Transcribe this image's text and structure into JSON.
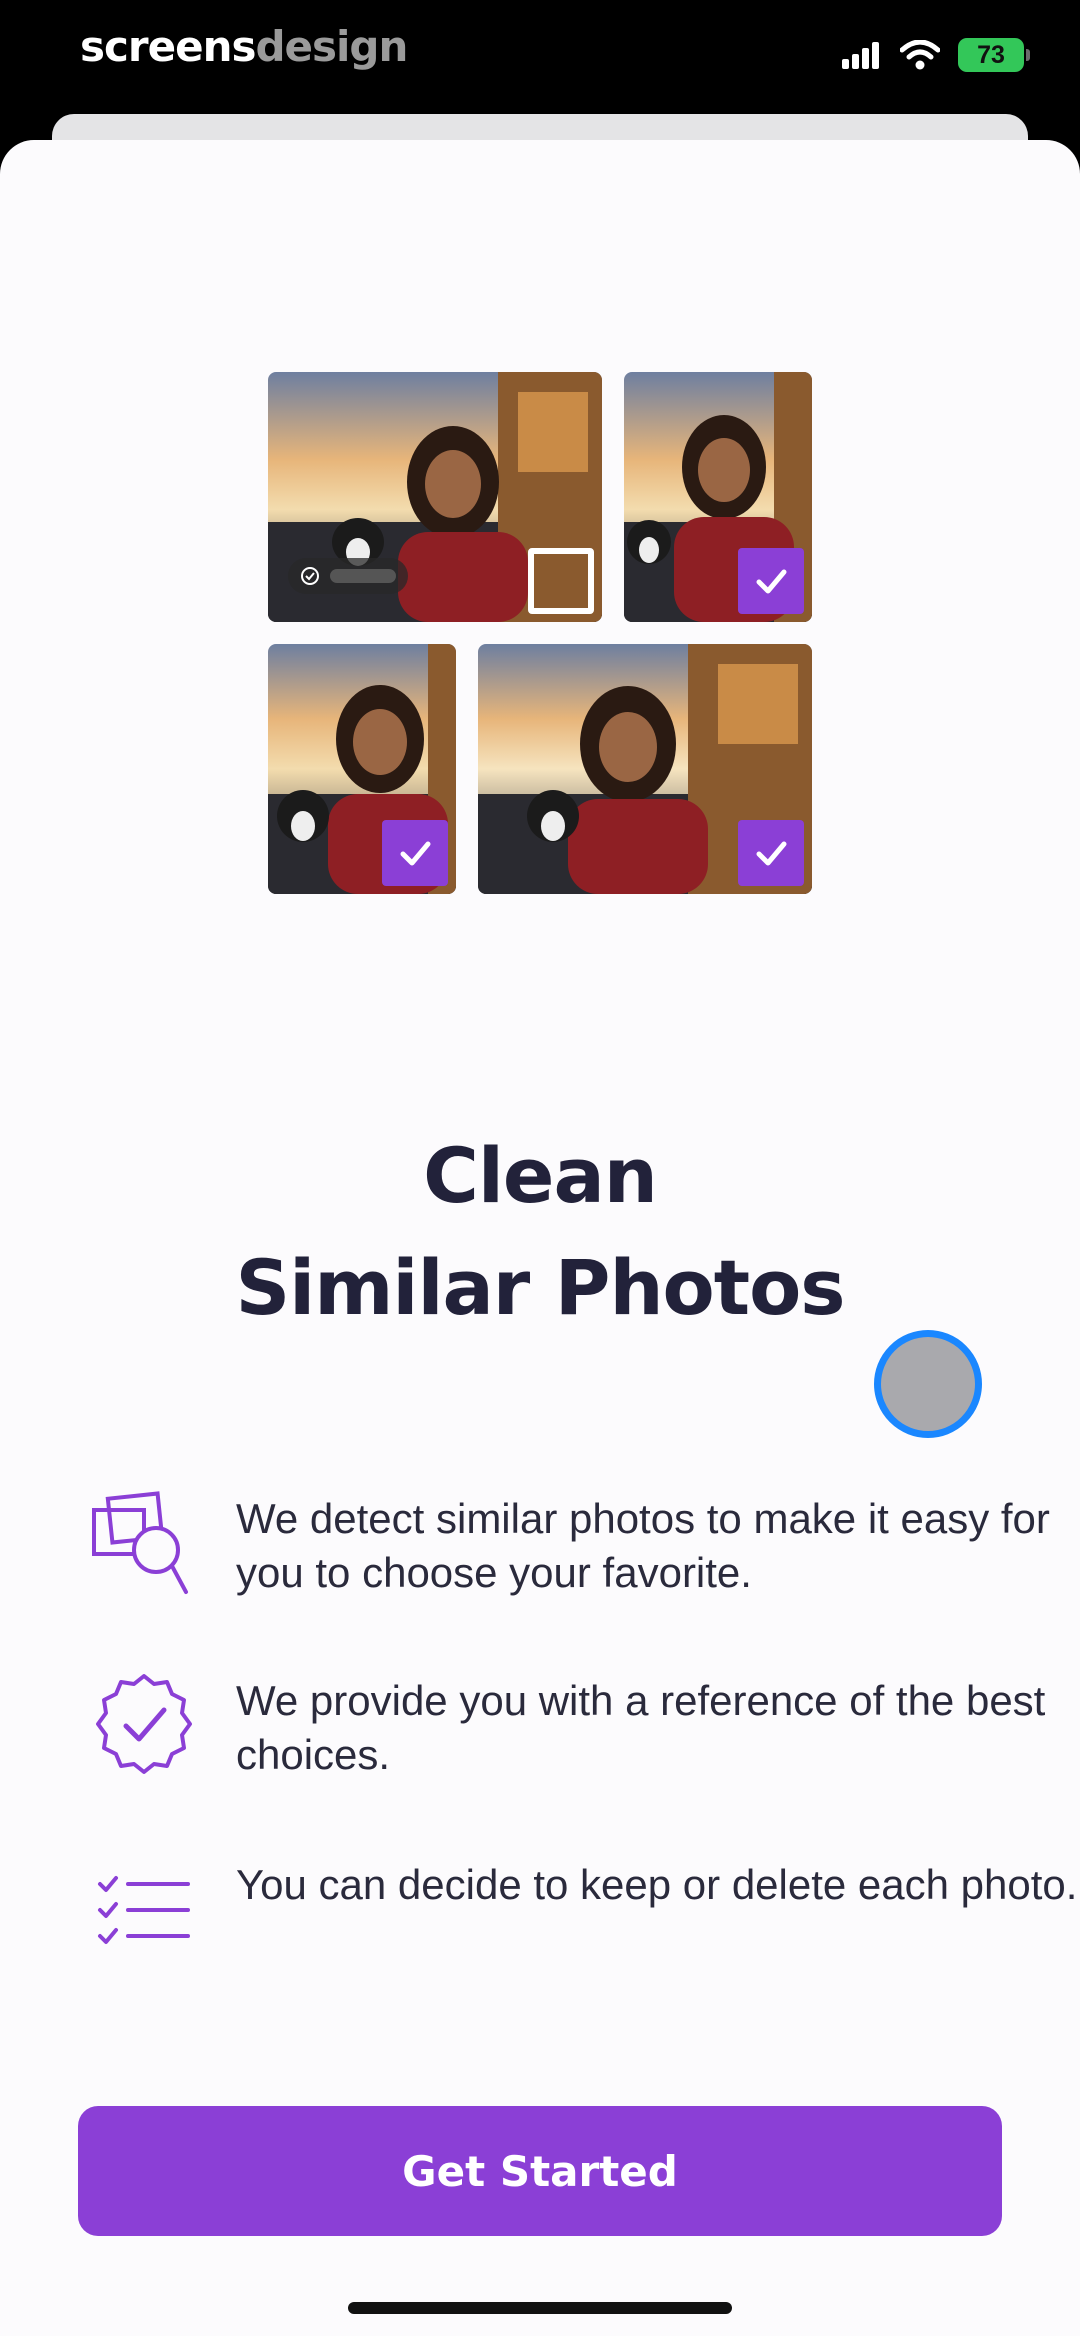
{
  "status_bar": {
    "brand_part1": "screens",
    "brand_part2": "design",
    "battery": "73",
    "icons": [
      "cellular-signal-icon",
      "wifi-icon",
      "battery-icon"
    ]
  },
  "collage": {
    "photos": [
      {
        "label": "photo-1",
        "selected": false,
        "best_badge": true
      },
      {
        "label": "photo-2",
        "selected": true
      },
      {
        "label": "photo-3",
        "selected": true
      },
      {
        "label": "photo-4",
        "selected": true
      }
    ]
  },
  "title": {
    "line1": "Clean",
    "line2": "Similar Photos"
  },
  "features": [
    {
      "icon": "similar-photos-search-icon",
      "text": "We detect similar photos to make it easy for you to choose your favorite."
    },
    {
      "icon": "verified-badge-icon",
      "text": "We provide you with a reference of the best choices."
    },
    {
      "icon": "checklist-icon",
      "text": "You can decide to keep or delete each photo."
    }
  ],
  "cta": {
    "label": "Get Started"
  },
  "colors": {
    "accent": "#8b3fd6",
    "title": "#22223a",
    "background": "#fcfbfd"
  }
}
